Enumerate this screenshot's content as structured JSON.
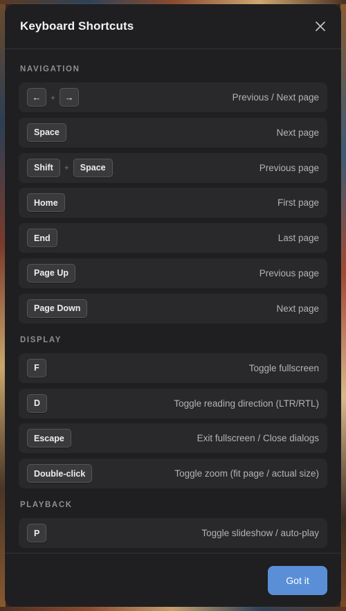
{
  "dialog": {
    "title": "Keyboard Shortcuts",
    "close_icon": "close-icon",
    "primary_button": "Got it"
  },
  "colors": {
    "accent": "#5a8fd8",
    "panel": "#1f1f21",
    "row": "#29292b"
  },
  "sections": [
    {
      "title": "NAVIGATION",
      "rows": [
        {
          "keys": [
            "←",
            "→"
          ],
          "desc": "Previous / Next page"
        },
        {
          "keys": [
            "Space"
          ],
          "desc": "Next page"
        },
        {
          "keys": [
            "Shift",
            "Space"
          ],
          "desc": "Previous page"
        },
        {
          "keys": [
            "Home"
          ],
          "desc": "First page"
        },
        {
          "keys": [
            "End"
          ],
          "desc": "Last page"
        },
        {
          "keys": [
            "Page Up"
          ],
          "desc": "Previous page"
        },
        {
          "keys": [
            "Page Down"
          ],
          "desc": "Next page"
        }
      ]
    },
    {
      "title": "DISPLAY",
      "rows": [
        {
          "keys": [
            "F"
          ],
          "desc": "Toggle fullscreen"
        },
        {
          "keys": [
            "D"
          ],
          "desc": "Toggle reading direction (LTR/RTL)"
        },
        {
          "keys": [
            "Escape"
          ],
          "desc": "Exit fullscreen / Close dialogs"
        },
        {
          "keys": [
            "Double-click"
          ],
          "desc": "Toggle zoom (fit page / actual size)"
        }
      ]
    },
    {
      "title": "PLAYBACK",
      "rows": [
        {
          "keys": [
            "P"
          ],
          "desc": "Toggle slideshow / auto-play"
        }
      ]
    }
  ],
  "key_separator": "+"
}
